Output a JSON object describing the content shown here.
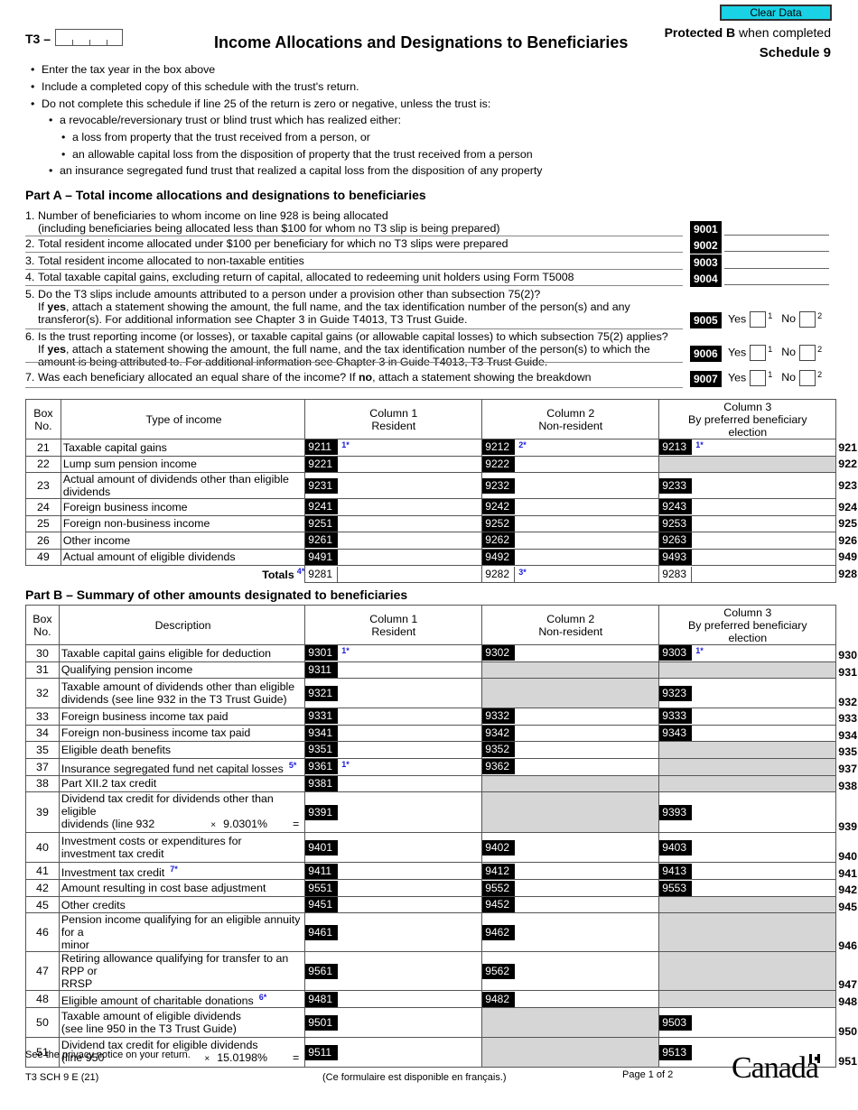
{
  "header": {
    "clear_button": "Clear Data",
    "form_prefix": "T3 –",
    "title": "Income Allocations and Designations to Beneficiaries",
    "protected_bold": "Protected B",
    "protected_rest": " when completed",
    "schedule": "Schedule 9"
  },
  "instructions": [
    {
      "text": "Enter the tax year in the box above",
      "level": 0
    },
    {
      "text": "Include a completed copy of this schedule with the trust's return.",
      "level": 0
    },
    {
      "text": "Do not complete this schedule if line 25 of the return is zero or negative, unless the trust is:",
      "level": 0
    },
    {
      "text": "a revocable/reversionary trust or blind trust which has realized either:",
      "level": 1
    },
    {
      "text": "a loss from property that the trust received from a person, or",
      "level": 2
    },
    {
      "text": "an allowable capital loss from the disposition of property that the trust received from a person",
      "level": 2
    },
    {
      "text": "an insurance segregated fund trust that realized a capital loss from the disposition of any property",
      "level": 1
    }
  ],
  "part_a": {
    "title_bold": "Part A",
    "title_rest": " – Total income allocations and designations to beneficiaries",
    "questions": [
      {
        "num": "1.",
        "lines": [
          "Number of beneficiaries to whom income on line 928 is being allocated",
          "(including beneficiaries being allocated less than $100 for whom no T3 slip is being prepared)"
        ],
        "code": "9001"
      },
      {
        "num": "2.",
        "lines": [
          "Total resident income allocated under $100 per beneficiary for which no T3 slips were prepared"
        ],
        "code": "9002"
      },
      {
        "num": "3.",
        "lines": [
          "Total resident income allocated to non-taxable entities"
        ],
        "code": "9003"
      },
      {
        "num": "4.",
        "lines": [
          "Total taxable capital gains, excluding return of capital, allocated to redeeming unit holders using Form T5008"
        ],
        "code": "9004"
      }
    ],
    "yes_no_questions": [
      {
        "num": "5.",
        "line1": "Do the T3 slips include amounts attributed to a person under a provision other than subsection 75(2)?",
        "line2_bold": "yes",
        "line2_pre": "If ",
        "line2_post": ", attach a statement showing the amount, the full name, and the tax identification number of the person(s) and any",
        "line3": "transferor(s). For additional information see Chapter 3 in Guide T4013, T3 Trust Guide.",
        "code": "9005"
      },
      {
        "num": "6.",
        "line1": "Is the trust reporting income (or losses), or taxable capital gains (or allowable capital losses) to which subsection 75(2) applies?",
        "line2_bold": "yes",
        "line2_pre": "If ",
        "line2_post": ", attach a statement showing the amount, the full name, and the tax identification number of the person(s) to which the",
        "line3": "amount is being attributed to. For additional information see Chapter 3 in Guide T4013, T3 Trust Guide.",
        "code": "9006"
      },
      {
        "num": "7.",
        "line1_pre": "Was each beneficiary allocated an equal share of the income? If ",
        "line1_bold": "no",
        "line1_post": ", attach a statement showing the breakdown",
        "code": "9007"
      }
    ],
    "yes_label": "Yes",
    "yes_value": "1",
    "no_label": "No",
    "no_value": "2"
  },
  "table_a": {
    "headers": {
      "box": [
        "Box",
        "No."
      ],
      "desc": "Type of income",
      "col1": [
        "Column 1",
        "Resident"
      ],
      "col2": [
        "Column 2",
        "Non-resident"
      ],
      "col3": [
        "Column 3",
        "By preferred beneficiary",
        "election"
      ]
    },
    "rows": [
      {
        "box": "21",
        "desc": "Taxable capital gains",
        "c1": "9211",
        "c1fn": "1*",
        "c2": "9212",
        "c2fn": "2*",
        "c3": "9213",
        "c3fn": "1*",
        "line": "921"
      },
      {
        "box": "22",
        "desc": "Lump sum pension income",
        "c1": "9221",
        "c2": "9222",
        "c3": null,
        "line": "922"
      },
      {
        "box": "23",
        "desc": "Actual amount of dividends other than eligible dividends",
        "c1": "9231",
        "c2": "9232",
        "c3": "9233",
        "line": "923"
      },
      {
        "box": "24",
        "desc": "Foreign business income",
        "c1": "9241",
        "c2": "9242",
        "c3": "9243",
        "line": "924"
      },
      {
        "box": "25",
        "desc": "Foreign non-business income",
        "c1": "9251",
        "c2": "9252",
        "c3": "9253",
        "line": "925"
      },
      {
        "box": "26",
        "desc": "Other income",
        "c1": "9261",
        "c2": "9262",
        "c3": "9263",
        "line": "926"
      },
      {
        "box": "49",
        "desc": "Actual amount of eligible dividends",
        "c1": "9491",
        "c2": "9492",
        "c3": "9493",
        "line": "949"
      }
    ],
    "totals": {
      "label": "Totals",
      "fn": "4*",
      "c1": "9281",
      "c2": "9282",
      "c2fn": "3*",
      "c3": "9283",
      "line": "928"
    }
  },
  "part_b": {
    "title_bold": "Part B",
    "title_rest": " – Summary of other amounts designated to beneficiaries"
  },
  "table_b": {
    "headers": {
      "box": [
        "Box",
        "No."
      ],
      "desc": "Description",
      "col1": [
        "Column 1",
        "Resident"
      ],
      "col2": [
        "Column 2",
        "Non-resident"
      ],
      "col3": [
        "Column 3",
        "By preferred beneficiary",
        "election"
      ]
    },
    "rows": [
      {
        "box": "30",
        "desc": [
          "Taxable capital gains eligible for deduction"
        ],
        "c1": "9301",
        "c1fn": "1*",
        "c2": "9302",
        "c3": "9303",
        "c3fn": "1*",
        "line": "930"
      },
      {
        "box": "31",
        "desc": [
          "Qualifying pension income"
        ],
        "c1": "9311",
        "c2": null,
        "c3": null,
        "line": "931"
      },
      {
        "box": "32",
        "desc": [
          "Taxable amount of dividends other than eligible",
          "dividends (see line 932 in the T3 Trust Guide)"
        ],
        "c1": "9321",
        "c2": null,
        "c3": "9323",
        "line": "932"
      },
      {
        "box": "33",
        "desc": [
          "Foreign business income tax paid"
        ],
        "c1": "9331",
        "c2": "9332",
        "c3": "9333",
        "line": "933"
      },
      {
        "box": "34",
        "desc": [
          "Foreign non-business income tax paid"
        ],
        "c1": "9341",
        "c2": "9342",
        "c3": "9343",
        "line": "934"
      },
      {
        "box": "35",
        "desc": [
          "Eligible death benefits"
        ],
        "c1": "9351",
        "c2": "9352",
        "c3": null,
        "line": "935"
      },
      {
        "box": "37",
        "desc": [
          "Insurance segregated fund net capital losses"
        ],
        "descfn": "5*",
        "c1": "9361",
        "c1fn": "1*",
        "c2": "9362",
        "c3": null,
        "line": "937"
      },
      {
        "box": "38",
        "desc": [
          "Part XII.2 tax credit"
        ],
        "c1": "9381",
        "c2": null,
        "c3": null,
        "line": "938"
      },
      {
        "box": "39",
        "desc": [
          "Dividend tax credit for dividends other than eligible"
        ],
        "calc": {
          "pre": "dividends (line 932",
          "op": "×",
          "rate": "9.0301%",
          "eq": "="
        },
        "c1": "9391",
        "c2": null,
        "c3": "9393",
        "line": "939"
      },
      {
        "box": "40",
        "desc": [
          "Investment costs or expenditures for",
          "investment tax credit"
        ],
        "c1": "9401",
        "c2": "9402",
        "c3": "9403",
        "line": "940"
      },
      {
        "box": "41",
        "desc": [
          "Investment tax credit"
        ],
        "descfn": "7*",
        "c1": "9411",
        "c2": "9412",
        "c3": "9413",
        "line": "941"
      },
      {
        "box": "42",
        "desc": [
          "Amount resulting in cost base adjustment"
        ],
        "c1": "9551",
        "c2": "9552",
        "c3": "9553",
        "line": "942"
      },
      {
        "box": "45",
        "desc": [
          "Other credits"
        ],
        "c1": "9451",
        "c2": "9452",
        "c3": null,
        "line": "945"
      },
      {
        "box": "46",
        "desc": [
          "Pension income qualifying for an eligible annuity for a",
          "minor"
        ],
        "c1": "9461",
        "c2": "9462",
        "c3": null,
        "line": "946"
      },
      {
        "box": "47",
        "desc": [
          "Retiring allowance qualifying for transfer  to an RPP or",
          "RRSP"
        ],
        "c1": "9561",
        "c2": "9562",
        "c3": null,
        "line": "947"
      },
      {
        "box": "48",
        "desc": [
          "Eligible amount of charitable donations"
        ],
        "descfn": "6*",
        "c1": "9481",
        "c2": "9482",
        "c3": null,
        "line": "948"
      },
      {
        "box": "50",
        "desc": [
          "Taxable amount of eligible dividends",
          "(see line 950 in the T3 Trust Guide)"
        ],
        "c1": "9501",
        "c2": null,
        "c3": "9503",
        "line": "950"
      },
      {
        "box": "51",
        "desc": [
          "Dividend tax credit for eligible dividends"
        ],
        "calc": {
          "pre": "(line 950",
          "op": "×",
          "rate": "15.0198%",
          "eq": "="
        },
        "c1": "9511",
        "c2": null,
        "c3": "9513",
        "line": "951"
      }
    ]
  },
  "footer": {
    "privacy": "See the privacy notice on your return.",
    "form_code": "T3 SCH 9 E (21)",
    "french": "(Ce formulaire est disponible en français.)",
    "page": "Page 1 of 2",
    "wordmark": "Canada"
  }
}
